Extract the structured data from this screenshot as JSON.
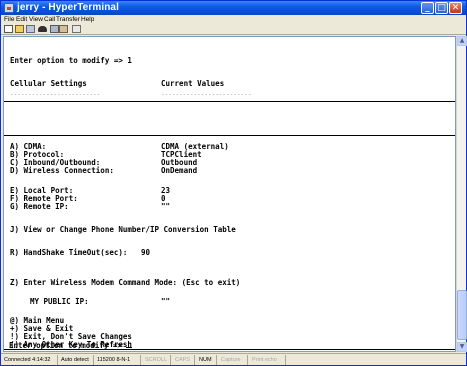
{
  "window": {
    "title": "jerry - HyperTerminal",
    "controls": {
      "minimize": "_",
      "maximize": "□",
      "close": "✕"
    }
  },
  "menu": {
    "items": [
      "File",
      "Edit",
      "View",
      "Call",
      "Transfer",
      "Help"
    ]
  },
  "toolbar": {
    "icons": [
      "new-connection-icon",
      "open-icon",
      "disconnect-icon",
      "phone-icon",
      "send-icon",
      "receive-icon",
      "properties-icon"
    ]
  },
  "terminal": {
    "prompt_top": "Enter option to modify => 1",
    "header_settings": "Cellular Settings",
    "header_values": "Current Values",
    "dashes_settings": "-------------------------",
    "dashes_values": "-------------------------",
    "rows": [
      {
        "label": "A) CDMA:",
        "value": "CDMA (external)"
      },
      {
        "label": "B) Protocol:",
        "value": "TCPClient"
      },
      {
        "label": "C) Inbound/Outbound:",
        "value": "Outbound"
      },
      {
        "label": "D) Wireless Connection:",
        "value": "OnDemand"
      },
      {
        "label": "E) Local Port:",
        "value": "23"
      },
      {
        "label": "F) Remote Port:",
        "value": "0"
      },
      {
        "label": "G) Remote IP:",
        "value": "\"\""
      }
    ],
    "option_j": "J) View or Change Phone Number/IP Conversion Table",
    "option_r_label": "R) HandShake TimeOut(sec):",
    "option_r_value": "90",
    "option_z": "Z) Enter Wireless Modem Command Mode: (Esc to exit)",
    "public_ip_label": "MY PUBLIC IP:",
    "public_ip_value": "\"\"",
    "menu_options": [
      "@) Main Menu",
      "+) Save & Exit",
      "!) Exit, Don't Save Changes",
      "() Any Other Key To Refresh"
    ],
    "prompt_bottom": "Enter option to modify => "
  },
  "statusbar": {
    "connected": "Connected 4:14:32",
    "detect": "Auto detect",
    "settings": "115200 8-N-1",
    "scroll": "SCROLL",
    "caps": "CAPS",
    "num": "NUM",
    "capture": "Capture",
    "print_echo": "Print echo"
  }
}
